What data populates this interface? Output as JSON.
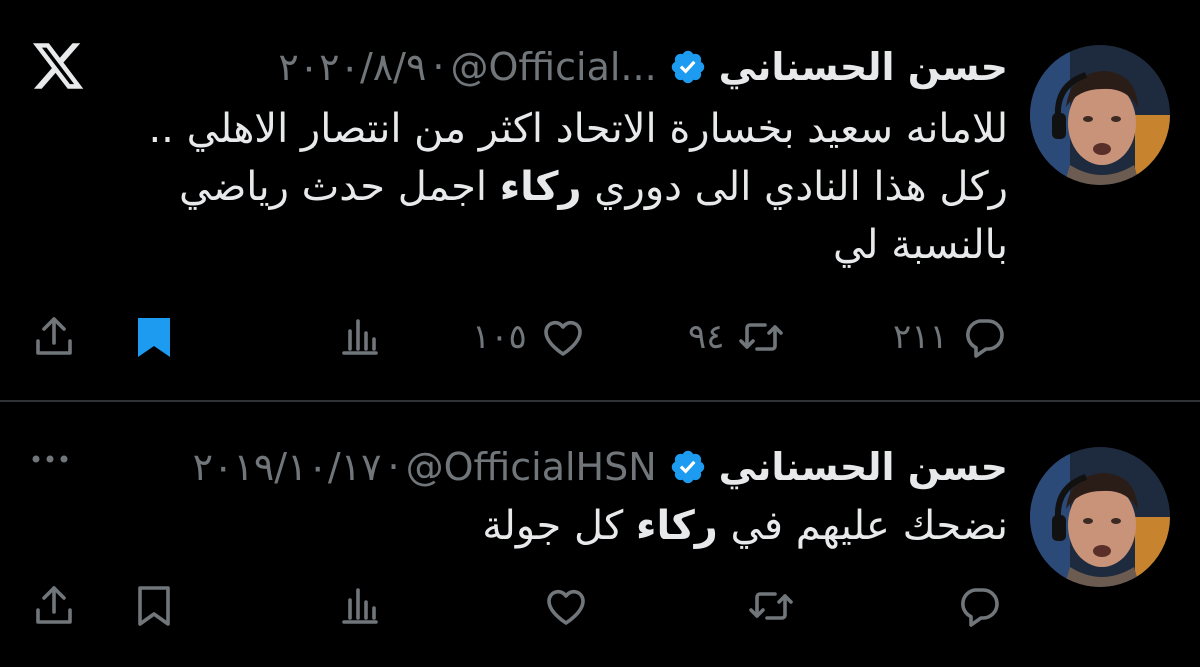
{
  "tweets": [
    {
      "author_name": "حسن الحسناني",
      "handle": "@Official...",
      "separator": "·",
      "date": "٢٠٢٠/٨/٩",
      "text_line_1": "للامانه سعيد بخسارة الاتحاد اكثر من انتصار الاهلي ..",
      "text_line_2_pre": "ركل هذا النادي الى دوري ",
      "text_line_2_bold": "ركاء",
      "text_line_2_post": " اجمل حدث رياضي",
      "text_line_3": "بالنسبة لي",
      "replies": "٢١١",
      "retweets": "٩٤",
      "likes": "١٠٥",
      "bookmarked": true,
      "top_icon": "x-logo-icon"
    },
    {
      "author_name": "حسن الحسناني",
      "handle": "@OfficialHSN",
      "separator": "·",
      "date": "٢٠١٩/١٠/١٧",
      "text_pre": "نضحك عليهم في ",
      "text_bold": "ركاء",
      "text_post": " كل جولة",
      "bookmarked": false,
      "top_icon": "more-icon"
    }
  ],
  "colors": {
    "background": "#000000",
    "text": "#e7e9ea",
    "muted": "#71767b",
    "verified": "#1d9bf0",
    "divider": "#2f3336"
  }
}
